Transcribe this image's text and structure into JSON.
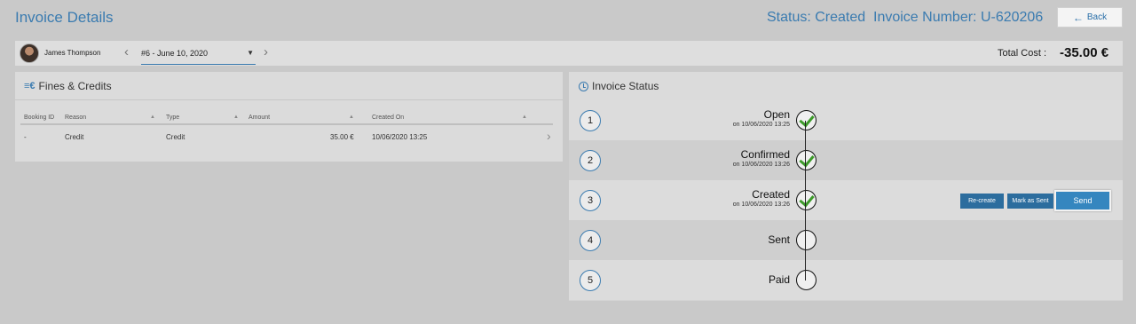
{
  "header": {
    "title": "Invoice Details",
    "status": "Status: Created",
    "invoice_number": "Invoice Number: U-620206",
    "back_label": "Back",
    "back_icon": "arrow-left-icon"
  },
  "customer_bar": {
    "user_name": "James Thompson",
    "invoice_selected": "#6 - June 10, 2020",
    "total_label": "Total Cost :",
    "total_value": "-35.00 €"
  },
  "fines_panel": {
    "title": "Fines & Credits",
    "columns": [
      "Booking ID",
      "Reason",
      "Type",
      "Amount",
      "Created On"
    ],
    "rows": [
      {
        "booking_id": "-",
        "reason": "Credit",
        "type": "Credit",
        "amount": "35.00 €",
        "created_on": "10/06/2020 13:25"
      }
    ]
  },
  "status_panel": {
    "title": "Invoice Status",
    "steps": [
      {
        "num": "1",
        "name": "Open",
        "date": "on 10/06/2020 13:25",
        "done": true
      },
      {
        "num": "2",
        "name": "Confirmed",
        "date": "on 10/06/2020 13:26",
        "done": true
      },
      {
        "num": "3",
        "name": "Created",
        "date": "on 10/06/2020 13:26",
        "done": true
      },
      {
        "num": "4",
        "name": "Sent",
        "date": "",
        "done": false
      },
      {
        "num": "5",
        "name": "Paid",
        "date": "",
        "done": false
      }
    ],
    "actions": {
      "recreate": "Re-create",
      "mark_sent": "Mark as Sent",
      "send": "Send"
    }
  },
  "colors": {
    "accent": "#3a7bb0",
    "button": "#2c6d9e",
    "check": "#3d9a2a",
    "background": "#c9c9c9"
  }
}
